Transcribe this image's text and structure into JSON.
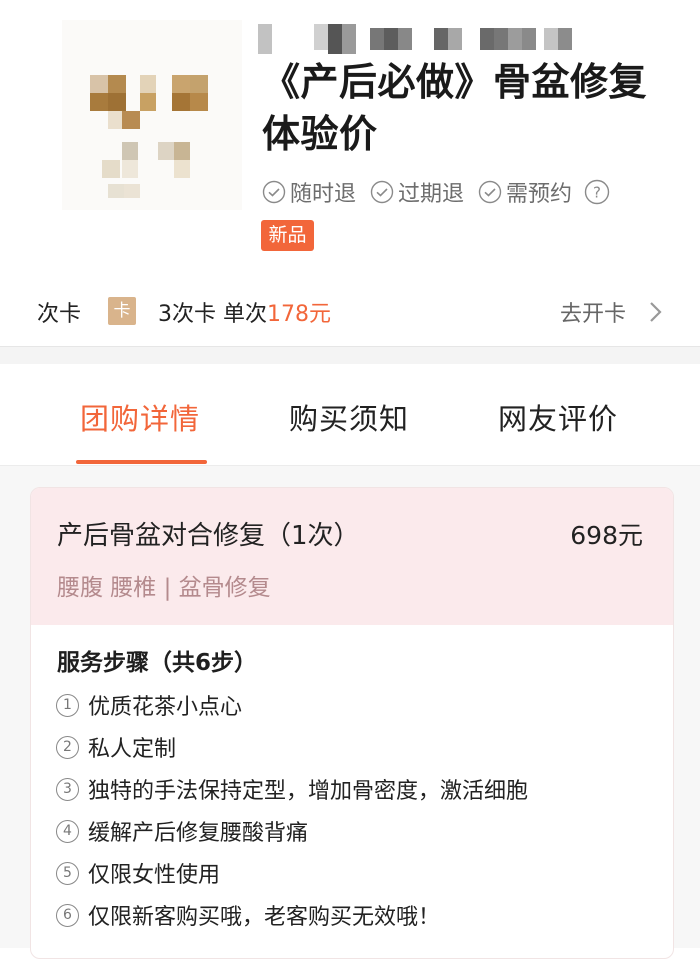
{
  "product": {
    "title": "《产后必做》骨盆修复体验价",
    "guarantees": [
      "随时退",
      "过期退",
      "需预约"
    ],
    "badge": "新品"
  },
  "card_row": {
    "label": "次卡",
    "badge": "卡",
    "desc": "3次卡 单次",
    "price": "178元",
    "action": "去开卡"
  },
  "tabs": [
    {
      "label": "团购详情",
      "active": true
    },
    {
      "label": "购买须知",
      "active": false
    },
    {
      "label": "网友评价",
      "active": false
    }
  ],
  "package": {
    "name": "产后骨盆对合修复（1次）",
    "price": "698元",
    "tags": "腰腹 腰椎 | 盆骨修复",
    "steps_title": "服务步骤（共6步）",
    "steps": [
      {
        "num": "1",
        "text": "优质花茶小点心"
      },
      {
        "num": "2",
        "text": "私人定制"
      },
      {
        "num": "3",
        "text": "独特的手法保持定型，增加骨密度，激活细胞"
      },
      {
        "num": "4",
        "text": "缓解产后修复腰酸背痛"
      },
      {
        "num": "5",
        "text": "仅限女性使用"
      },
      {
        "num": "6",
        "text": "仅限新客购买哦，老客购买无效哦！"
      }
    ]
  },
  "colors": {
    "accent": "#f2663a",
    "card_badge": "#d9b48c",
    "pink_header": "#fbeaec",
    "tag_text": "#b48a8d"
  }
}
